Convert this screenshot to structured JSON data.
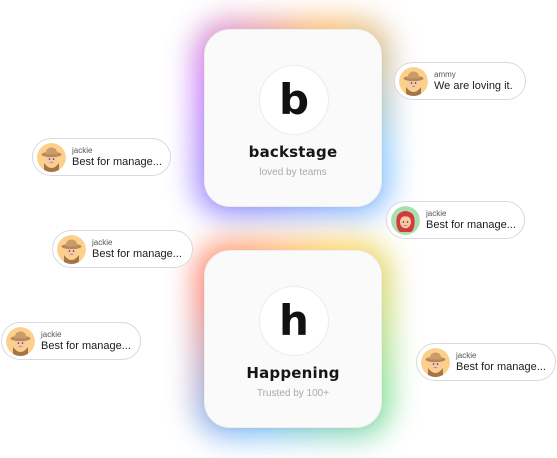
{
  "cards": [
    {
      "logo_letter": "b",
      "title": "backstage",
      "subtitle": "loved by teams",
      "glow_colors": [
        "#7f8bff",
        "#c36bff",
        "#ffb14a",
        "#7fc8ff"
      ]
    },
    {
      "logo_letter": "h",
      "title": "Happening",
      "subtitle": "Trusted by 100+",
      "glow_colors": [
        "#ff7a6b",
        "#ffcf4a",
        "#7ae08a",
        "#6fb4ff"
      ]
    }
  ],
  "comments": [
    {
      "name": "ammy",
      "message": "We are loving it.",
      "avatar": "cowboy-hat-avatar-icon"
    },
    {
      "name": "jackie",
      "message": "Best for manage...",
      "avatar": "cowboy-hat-avatar-icon"
    },
    {
      "name": "jackie",
      "message": "Best for manage...",
      "avatar": "red-hair-avatar-icon"
    },
    {
      "name": "jackie",
      "message": "Best for manage...",
      "avatar": "cowboy-hat-avatar-icon"
    },
    {
      "name": "jackie",
      "message": "Best for manage...",
      "avatar": "cowboy-hat-avatar-icon"
    },
    {
      "name": "jackie",
      "message": "Best for manage...",
      "avatar": "cowboy-hat-avatar-icon"
    }
  ],
  "colors": {
    "avatar_bg_cowboy": "#fbd08a",
    "avatar_bg_redhair": "#a9dfb0",
    "hat": "#c99a6a",
    "skin": "#f6c9a8",
    "red_hair": "#d33b3b"
  }
}
